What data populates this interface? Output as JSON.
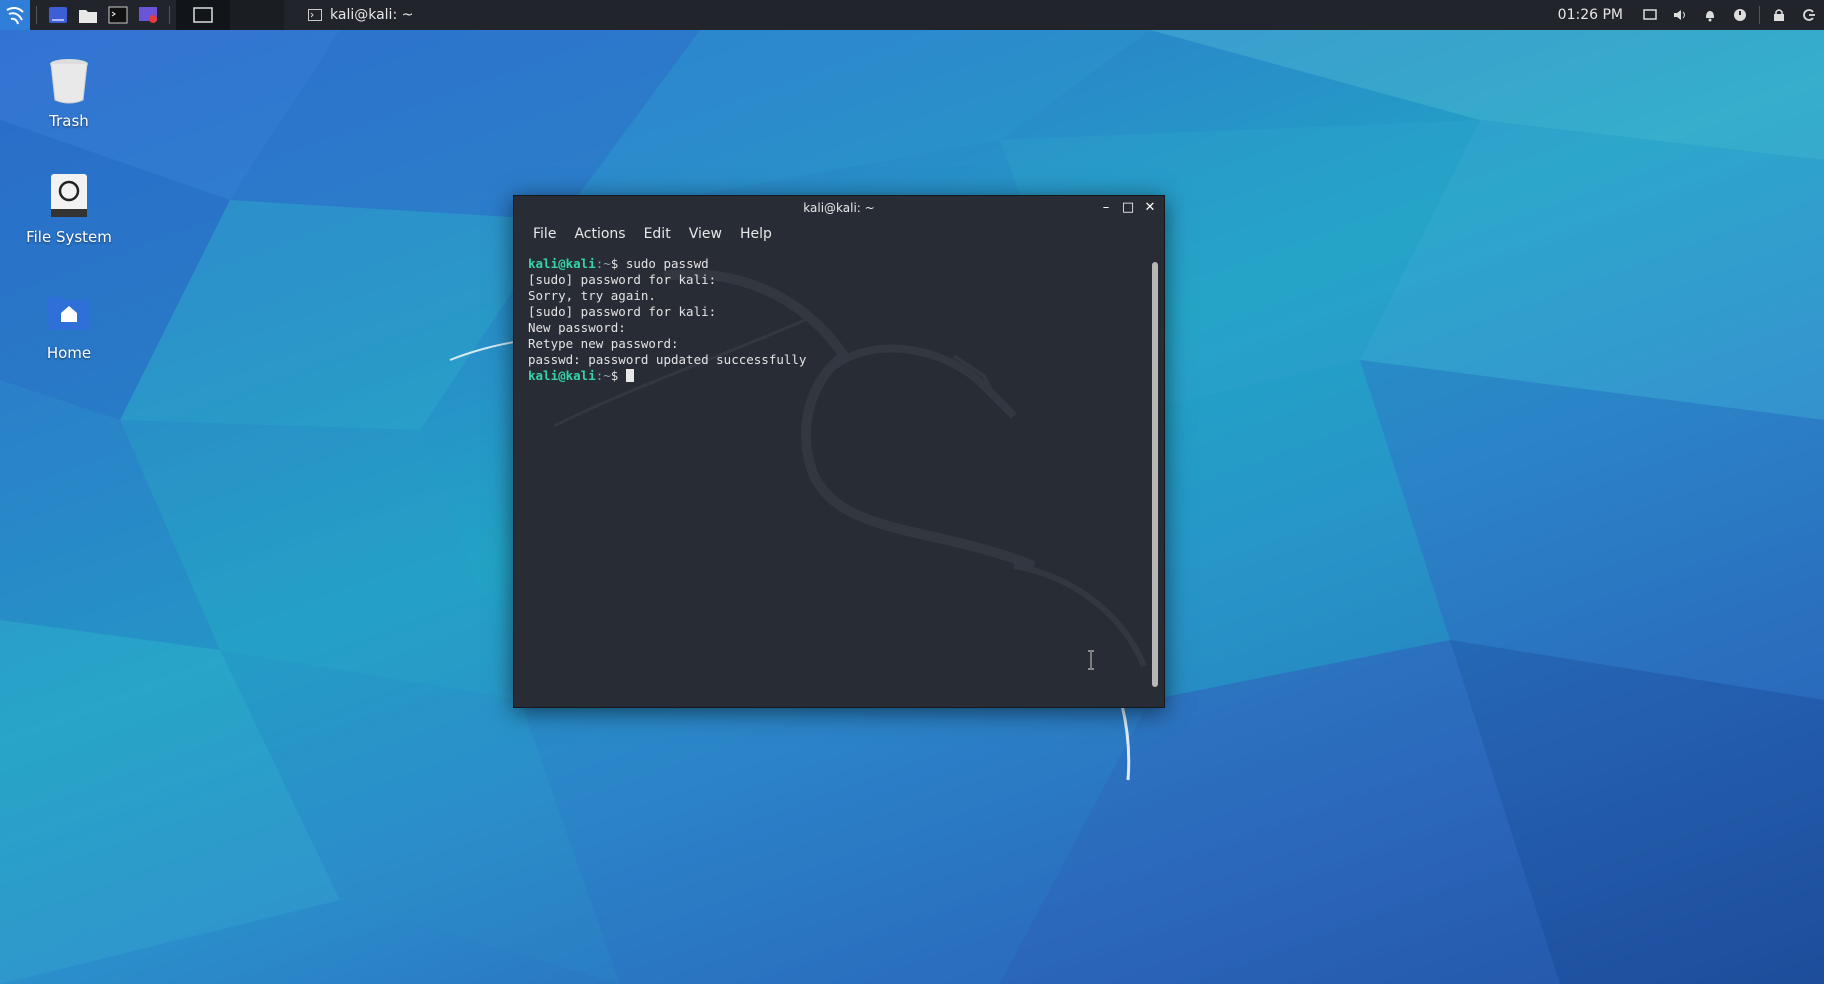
{
  "panel": {
    "task_title": "kali@kali: ~",
    "clock": "01:26 PM"
  },
  "desktop": {
    "icons": [
      {
        "label": "Trash"
      },
      {
        "label": "File System"
      },
      {
        "label": "Home"
      }
    ]
  },
  "terminal": {
    "title": "kali@kali: ~",
    "menu": [
      "File",
      "Actions",
      "Edit",
      "View",
      "Help"
    ],
    "prompt_user": "kali@kali",
    "prompt_path": ":~",
    "prompt_symbol": "$ ",
    "lines": [
      {
        "type": "cmd",
        "text": "sudo passwd"
      },
      {
        "type": "out",
        "text": "[sudo] password for kali:"
      },
      {
        "type": "out",
        "text": "Sorry, try again."
      },
      {
        "type": "out",
        "text": "[sudo] password for kali:"
      },
      {
        "type": "out",
        "text": "New password:"
      },
      {
        "type": "out",
        "text": "Retype new password:"
      },
      {
        "type": "out",
        "text": "passwd: password updated successfully"
      }
    ]
  },
  "colors": {
    "panel_bg": "#21252b",
    "terminal_bg": "#282c34",
    "prompt_color": "#36d3a7",
    "accent": "#2f7fd8"
  }
}
